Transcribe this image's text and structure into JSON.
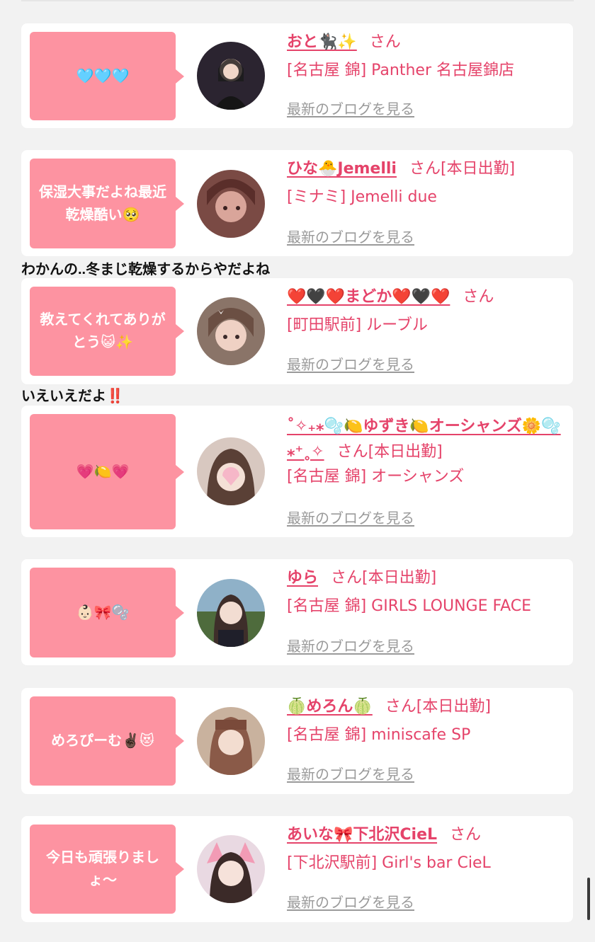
{
  "comments": [
    "わかんの..冬まじ乾燥するからやだよね",
    "いえいえだよ‼️"
  ],
  "cards": [
    {
      "bubble": "🩵🩵🩵",
      "name": "おと🐈‍⬛✨",
      "honorific": "さん",
      "shop": "[名古屋 錦] Panther 名古屋錦店",
      "blog_link": "最新のブログを見る"
    },
    {
      "bubble": "保湿大事だよね最近乾燥酷い🥺",
      "name": "ひな🐣Jemelli",
      "honorific": "さん[本日出勤]",
      "shop": "[ミナミ] Jemelli due",
      "blog_link": "最新のブログを見る"
    },
    {
      "bubble": "教えてくれてありがとう😺✨",
      "name": "❤️🖤❤️まどか❤️🖤❤️",
      "honorific": "さん",
      "shop": "[町田駅前] ルーブル",
      "blog_link": "最新のブログを見る"
    },
    {
      "bubble": "💗🍋💗",
      "name": "˚✧₊⁎🫧🍋ゆずき🍋オーシャンズ🌼🫧⁎⁺˳✧",
      "honorific": "さん[本日出勤]",
      "shop": "[名古屋 錦] オーシャンズ",
      "blog_link": "最新のブログを見る"
    },
    {
      "bubble": "👶🏻🎀🫧",
      "name": "ゆら",
      "honorific": "さん[本日出勤]",
      "shop": "[名古屋 錦] GIRLS LOUNGE FACE",
      "blog_link": "最新のブログを見る"
    },
    {
      "bubble": "めろぴーむ✌🏿😻",
      "name": "🍈めろん🍈",
      "honorific": "さん[本日出勤]",
      "shop": "[名古屋 錦] miniscafe SP",
      "blog_link": "最新のブログを見る"
    },
    {
      "bubble": "今日も頑張りましょ〜",
      "name": "あいな🎀下北沢CieL",
      "honorific": "さん",
      "shop": "[下北沢駅前] Girl's bar CieL",
      "blog_link": "最新のブログを見る"
    }
  ],
  "colors": {
    "bubble": "#fd93a1",
    "accent_text": "#e5436a",
    "link_gray": "#9a9a9a",
    "background": "#f2f2f2"
  }
}
